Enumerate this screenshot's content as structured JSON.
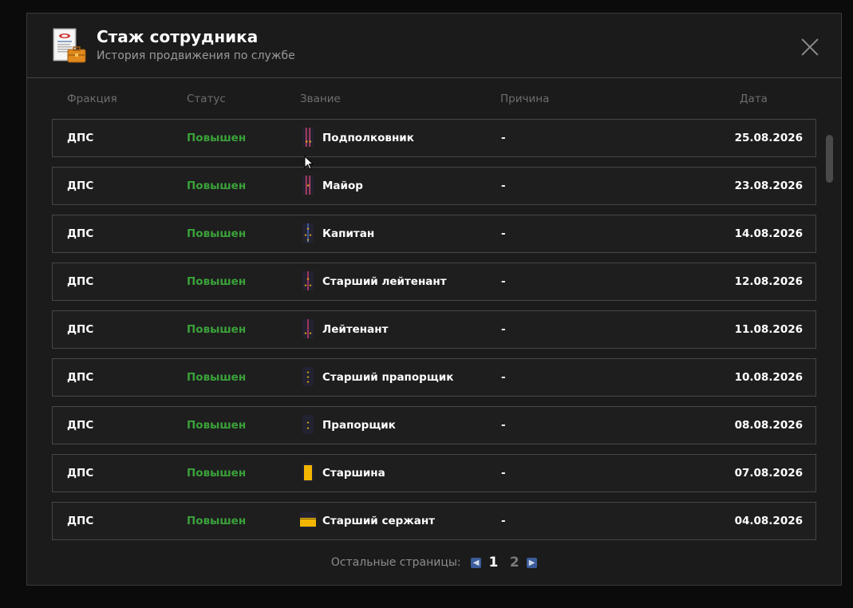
{
  "header": {
    "title": "Стаж сотрудника",
    "subtitle": "История продвижения по службе"
  },
  "columns": {
    "faction": "Фракция",
    "status": "Статус",
    "rank": "Звание",
    "reason": "Причина",
    "date": "Дата"
  },
  "rows": [
    {
      "faction": "ДПС",
      "status": "Повышен",
      "rank": "Подполковник",
      "rank_icon": "lt-colonel-shoulder-icon",
      "reason": "-",
      "date": "25.08.2026"
    },
    {
      "faction": "ДПС",
      "status": "Повышен",
      "rank": "Майор",
      "rank_icon": "major-shoulder-icon",
      "reason": "-",
      "date": "23.08.2026"
    },
    {
      "faction": "ДПС",
      "status": "Повышен",
      "rank": "Капитан",
      "rank_icon": "captain-shoulder-icon",
      "reason": "-",
      "date": "14.08.2026"
    },
    {
      "faction": "ДПС",
      "status": "Повышен",
      "rank": "Старший лейтенант",
      "rank_icon": "senior-lieutenant-shoulder-icon",
      "reason": "-",
      "date": "12.08.2026"
    },
    {
      "faction": "ДПС",
      "status": "Повышен",
      "rank": "Лейтенант",
      "rank_icon": "lieutenant-shoulder-icon",
      "reason": "-",
      "date": "11.08.2026"
    },
    {
      "faction": "ДПС",
      "status": "Повышен",
      "rank": "Старший прапорщик",
      "rank_icon": "senior-warrant-shoulder-icon",
      "reason": "-",
      "date": "10.08.2026"
    },
    {
      "faction": "ДПС",
      "status": "Повышен",
      "rank": "Прапорщик",
      "rank_icon": "warrant-shoulder-icon",
      "reason": "-",
      "date": "08.08.2026"
    },
    {
      "faction": "ДПС",
      "status": "Повышен",
      "rank": "Старшина",
      "rank_icon": "sergeant-major-shoulder-icon",
      "reason": "-",
      "date": "07.08.2026"
    },
    {
      "faction": "ДПС",
      "status": "Повышен",
      "rank": "Старший сержант",
      "rank_icon": "senior-sergeant-shoulder-icon",
      "reason": "-",
      "date": "04.08.2026"
    }
  ],
  "pagination": {
    "label": "Остальные страницы:",
    "pages": [
      "1",
      "2"
    ],
    "current": "1"
  },
  "icons": {
    "header": "certificate-briefcase-icon",
    "close": "close-icon",
    "prev": "chevron-left-icon",
    "next": "chevron-right-icon"
  },
  "colors": {
    "status_promoted": "#3aa13a",
    "accent": "#3b5c9a",
    "background": "#1b1b1b"
  }
}
